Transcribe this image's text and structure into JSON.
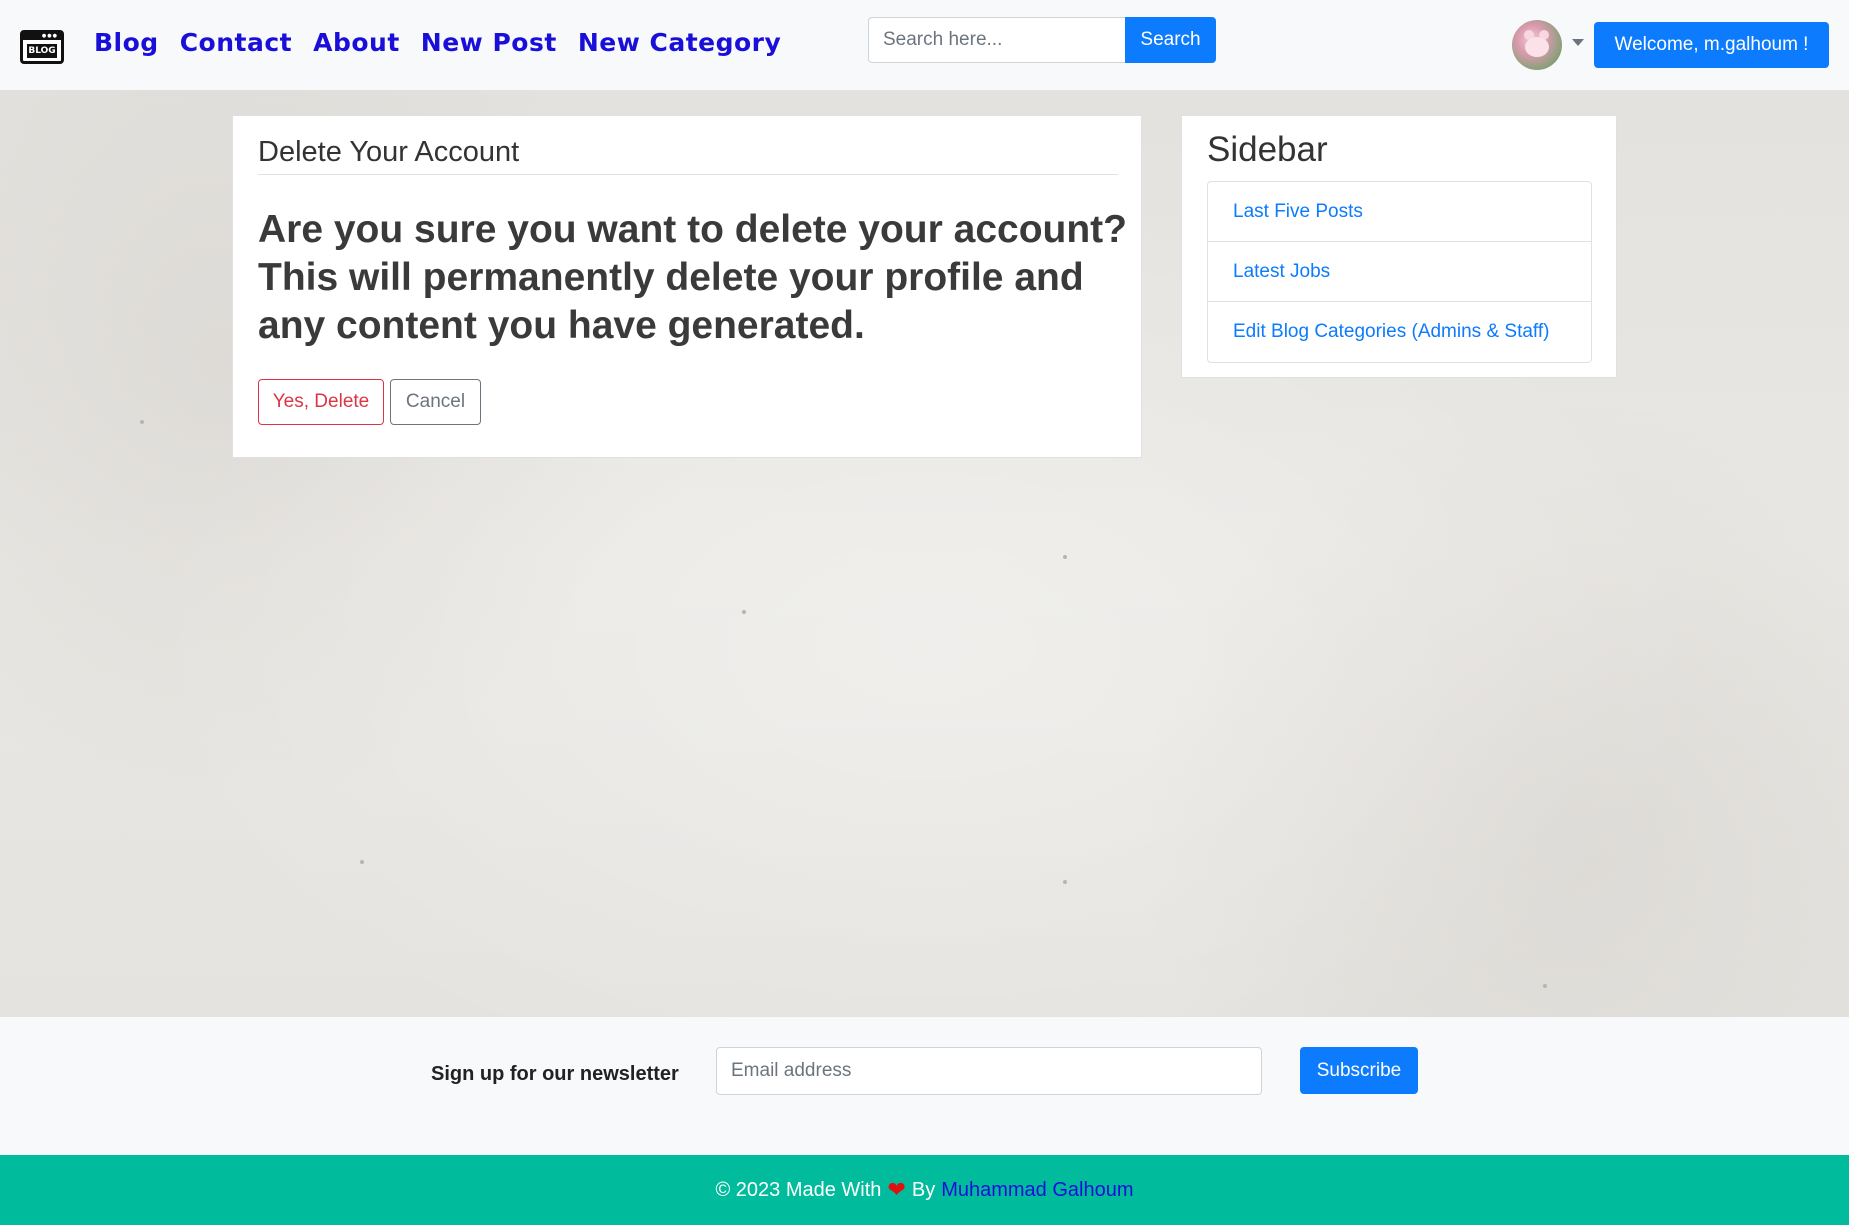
{
  "navbar": {
    "logo_text": "BLOG",
    "links": [
      "Blog",
      "Contact",
      "About",
      "New Post",
      "New Category"
    ],
    "search_placeholder": "Search here...",
    "search_button": "Search",
    "welcome_button": "Welcome, m.galhoum !"
  },
  "main": {
    "title": "Delete Your Account",
    "question": "Are you sure you want to delete your account? This will permanently delete your profile and any content you have generated.",
    "delete_button": "Yes, Delete",
    "cancel_button": "Cancel"
  },
  "sidebar": {
    "title": "Sidebar",
    "items": [
      {
        "label": "Last Five Posts"
      },
      {
        "label": "Latest Jobs"
      },
      {
        "label": "Edit Blog Categories (Admins & Staff)"
      }
    ]
  },
  "newsletter": {
    "label": "Sign up for our newsletter",
    "email_placeholder": "Email address",
    "subscribe_button": "Subscribe"
  },
  "footer": {
    "prefix": "© 2023 Made With",
    "heart_icon": "heart-icon",
    "by": "By",
    "author": "Muhammad Galhoum"
  },
  "colors": {
    "primary": "#0d7bfd",
    "nav_link": "#1a0fd9",
    "danger": "#dc3545",
    "footer_bg": "#00bc9c"
  }
}
